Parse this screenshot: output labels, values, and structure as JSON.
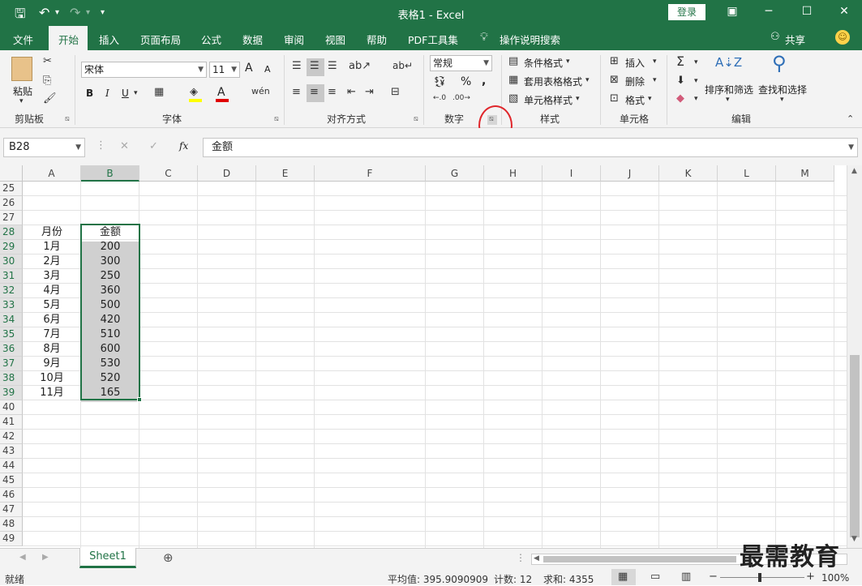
{
  "window": {
    "title": "表格1  -  Excel",
    "login_label": "登录",
    "qat_icons": [
      "save-icon",
      "undo-icon",
      "redo-icon",
      "customize-icon"
    ]
  },
  "menu": {
    "tabs": [
      "文件",
      "开始",
      "插入",
      "页面布局",
      "公式",
      "数据",
      "审阅",
      "视图",
      "帮助",
      "PDF工具集"
    ],
    "tell_me": "操作说明搜索",
    "share": "共享",
    "active_tab": "开始"
  },
  "ribbon": {
    "clipboard": {
      "paste": "粘贴",
      "label": "剪贴板"
    },
    "font": {
      "name": "宋体",
      "size": "11",
      "bold": "B",
      "italic": "I",
      "underline": "U",
      "fontcolor": "A",
      "grow": "A",
      "shrink": "A",
      "label": "字体"
    },
    "alignment": {
      "label": "对齐方式"
    },
    "number": {
      "format": "常规",
      "percent": "%",
      "comma": ",",
      "label": "数字"
    },
    "styles": {
      "conditional": "条件格式",
      "table": "套用表格格式",
      "cell": "单元格样式",
      "label": "样式"
    },
    "cells": {
      "insert": "插入",
      "delete": "删除",
      "format": "格式",
      "label": "单元格"
    },
    "editing": {
      "sort": "排序和筛选",
      "find": "查找和选择",
      "label": "编辑"
    }
  },
  "formula_bar": {
    "name_box": "B28",
    "fx": "fx",
    "value": "金额"
  },
  "grid": {
    "columns": [
      "A",
      "B",
      "C",
      "D",
      "E",
      "F",
      "G",
      "H",
      "I",
      "J",
      "K",
      "L",
      "M"
    ],
    "selected_column": "B",
    "rows": [
      "25",
      "26",
      "27",
      "28",
      "29",
      "30",
      "31",
      "32",
      "33",
      "34",
      "35",
      "36",
      "37",
      "38",
      "39",
      "40",
      "41",
      "42",
      "43",
      "44",
      "45",
      "46",
      "47",
      "48",
      "49"
    ],
    "selected_rows": [
      "28",
      "29",
      "30",
      "31",
      "32",
      "33",
      "34",
      "35",
      "36",
      "37",
      "38",
      "39"
    ],
    "header_month": "月份",
    "header_amount": "金额",
    "data": [
      {
        "month": "1月",
        "amount": "200"
      },
      {
        "month": "2月",
        "amount": "300"
      },
      {
        "month": "3月",
        "amount": "250"
      },
      {
        "month": "4月",
        "amount": "360"
      },
      {
        "month": "5月",
        "amount": "500"
      },
      {
        "month": "6月",
        "amount": "420"
      },
      {
        "month": "7月",
        "amount": "510"
      },
      {
        "month": "8月",
        "amount": "600"
      },
      {
        "month": "9月",
        "amount": "530"
      },
      {
        "month": "10月",
        "amount": "520"
      },
      {
        "month": "11月",
        "amount": "165"
      }
    ]
  },
  "sheets": {
    "active": "Sheet1"
  },
  "status": {
    "ready": "就绪",
    "average": "平均值: 395.9090909",
    "count": "计数: 12",
    "sum": "求和: 4355",
    "zoom": "100%"
  },
  "watermark": "最需教育",
  "colors": {
    "accent": "#217346",
    "selection_fill": "#d0d0d0",
    "annotation_circle": "#e0262b"
  }
}
